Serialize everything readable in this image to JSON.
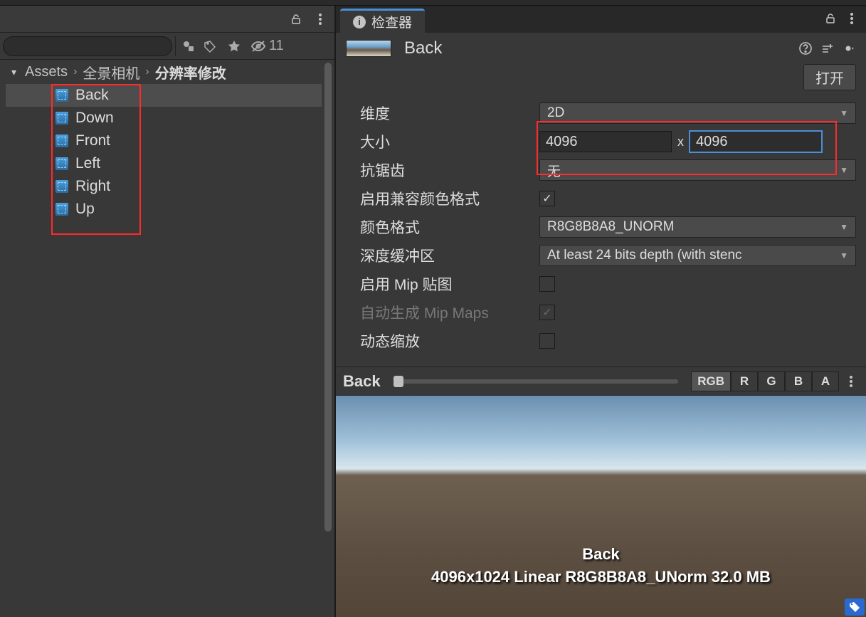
{
  "left": {
    "hidden_count": "11",
    "breadcrumb": [
      "Assets",
      "全景相机",
      "分辨率修改"
    ],
    "files": [
      {
        "name": "Back",
        "selected": true
      },
      {
        "name": "Down",
        "selected": false
      },
      {
        "name": "Front",
        "selected": false
      },
      {
        "name": "Left",
        "selected": false
      },
      {
        "name": "Right",
        "selected": false
      },
      {
        "name": "Up",
        "selected": false
      }
    ]
  },
  "inspector": {
    "tab_label": "检查器",
    "asset_name": "Back",
    "open_button": "打开",
    "props": {
      "dimension": {
        "label": "维度",
        "value": "2D"
      },
      "size": {
        "label": "大小",
        "w": "4096",
        "h": "4096"
      },
      "aa": {
        "label": "抗锯齿",
        "value": "无"
      },
      "compat": {
        "label": "启用兼容颜色格式",
        "checked": true
      },
      "format": {
        "label": "颜色格式",
        "value": "R8G8B8A8_UNORM"
      },
      "depth": {
        "label": "深度缓冲区",
        "value": "At least 24 bits depth (with stenc"
      },
      "mip": {
        "label": "启用 Mip 贴图",
        "checked": false
      },
      "automip": {
        "label": "自动生成 Mip Maps",
        "checked": true,
        "disabled": true
      },
      "dynscale": {
        "label": "动态缩放",
        "checked": false
      }
    },
    "preview": {
      "name": "Back",
      "channels": [
        "RGB",
        "R",
        "G",
        "B",
        "A"
      ],
      "active_channel": "RGB",
      "caption_line1": "Back",
      "caption_line2": "4096x1024 Linear  R8G8B8A8_UNorm  32.0 MB"
    }
  }
}
